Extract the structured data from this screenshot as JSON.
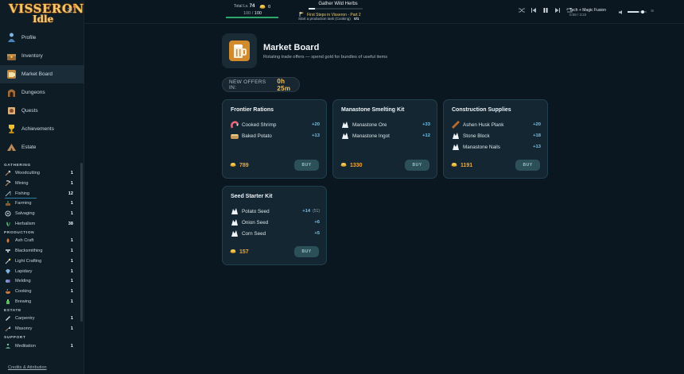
{
  "app": {
    "logo_line1": "VISSERON",
    "logo_line2": "Idle"
  },
  "nav": [
    {
      "label": "Profile",
      "icon": "person-icon"
    },
    {
      "label": "Inventory",
      "icon": "chest-icon"
    },
    {
      "label": "Market Board",
      "icon": "market-icon",
      "active": true
    },
    {
      "label": "Dungeons",
      "icon": "dungeon-icon"
    },
    {
      "label": "Quests",
      "icon": "quest-scroll-icon"
    },
    {
      "label": "Achievements",
      "icon": "trophy-icon"
    },
    {
      "label": "Estate",
      "icon": "estate-tent-icon"
    }
  ],
  "skill_sections": [
    {
      "title": "GATHERING",
      "skills": [
        {
          "name": "Woodcutting",
          "level": "1",
          "icon": "axe-icon"
        },
        {
          "name": "Mining",
          "level": "1",
          "icon": "pickaxe-icon"
        },
        {
          "name": "Fishing",
          "level": "12",
          "icon": "fishing-rod-icon",
          "progress": 0.5
        },
        {
          "name": "Farming",
          "level": "1",
          "icon": "farming-icon"
        },
        {
          "name": "Salvaging",
          "level": "1",
          "icon": "salvage-icon"
        },
        {
          "name": "Herbalism",
          "level": "38",
          "icon": "herb-icon"
        }
      ]
    },
    {
      "title": "PRODUCTION",
      "skills": [
        {
          "name": "Ash Craft",
          "level": "1",
          "icon": "ash-craft-icon"
        },
        {
          "name": "Blacksmithing",
          "level": "1",
          "icon": "anvil-icon"
        },
        {
          "name": "Light Crafting",
          "level": "1",
          "icon": "light-craft-icon"
        },
        {
          "name": "Lapidary",
          "level": "1",
          "icon": "gem-icon"
        },
        {
          "name": "Melding",
          "level": "1",
          "icon": "melding-icon"
        },
        {
          "name": "Cooking",
          "level": "1",
          "icon": "cooking-icon"
        },
        {
          "name": "Brewing",
          "level": "1",
          "icon": "brewing-icon"
        }
      ]
    },
    {
      "title": "ESTATE",
      "skills": [
        {
          "name": "Carpentry",
          "level": "1",
          "icon": "saw-icon"
        },
        {
          "name": "Masonry",
          "level": "1",
          "icon": "trowel-icon"
        }
      ]
    },
    {
      "title": "SUPPORT",
      "skills": [
        {
          "name": "Meditation",
          "level": "1",
          "icon": "meditation-icon"
        }
      ]
    }
  ],
  "credits": "Credits & Attribution",
  "topbar": {
    "total_label": "Total Lv.",
    "total_level": "74",
    "gold": "0",
    "hp_current": "100",
    "hp_sep": "/",
    "hp_max": "100",
    "hp_fill": 1.0,
    "activity": "Gather Wild Herbs",
    "activity_progress": 0.12,
    "quest_title": "First Steps in Visseron - Part 2",
    "quest_sub": "Start a production task (Cooking)",
    "quest_progress": "0/1"
  },
  "music": {
    "track": "Tech + Magic Fusion",
    "time": "0:08 / 3:22",
    "volume": 0.6
  },
  "market": {
    "title": "Market Board",
    "subtitle": "Rotating trade offers — spend gold for bundles of useful items",
    "new_offers_label": "NEW OFFERS IN:",
    "new_offers_time": "0h 25m",
    "buy_label": "BUY",
    "offers": [
      {
        "title": "Frontier Rations",
        "items": [
          {
            "name": "Cooked Shrimp",
            "qty": "+20",
            "icon": "shrimp-icon"
          },
          {
            "name": "Baked Potato",
            "qty": "+13",
            "icon": "potato-icon"
          }
        ],
        "price": "789"
      },
      {
        "title": "Manastone Smelting Kit",
        "items": [
          {
            "name": "Manastone Ore",
            "qty": "+33",
            "icon": "ore-icon"
          },
          {
            "name": "Manastone Ingot",
            "qty": "+12",
            "icon": "ingot-icon"
          }
        ],
        "price": "1330"
      },
      {
        "title": "Construction Supplies",
        "items": [
          {
            "name": "Ashen Husk Plank",
            "qty": "+20",
            "icon": "plank-icon"
          },
          {
            "name": "Stone Block",
            "qty": "+18",
            "icon": "stone-block-icon"
          },
          {
            "name": "Manastone Nails",
            "qty": "+13",
            "icon": "nails-icon"
          }
        ],
        "price": "1191"
      },
      {
        "title": "Seed Starter Kit",
        "items": [
          {
            "name": "Potato Seed",
            "qty": "+14",
            "extra": "(51)",
            "icon": "seed-icon"
          },
          {
            "name": "Onion Seed",
            "qty": "+6",
            "icon": "seed-icon"
          },
          {
            "name": "Corn Seed",
            "qty": "+5",
            "icon": "seed-icon"
          }
        ],
        "price": "157"
      }
    ]
  },
  "colors": {
    "background": "#0b1720",
    "card": "#132631",
    "accent_gold": "#f0a83a",
    "qty_blue": "#6fc3ef",
    "hp_green": "#2ca86b"
  }
}
